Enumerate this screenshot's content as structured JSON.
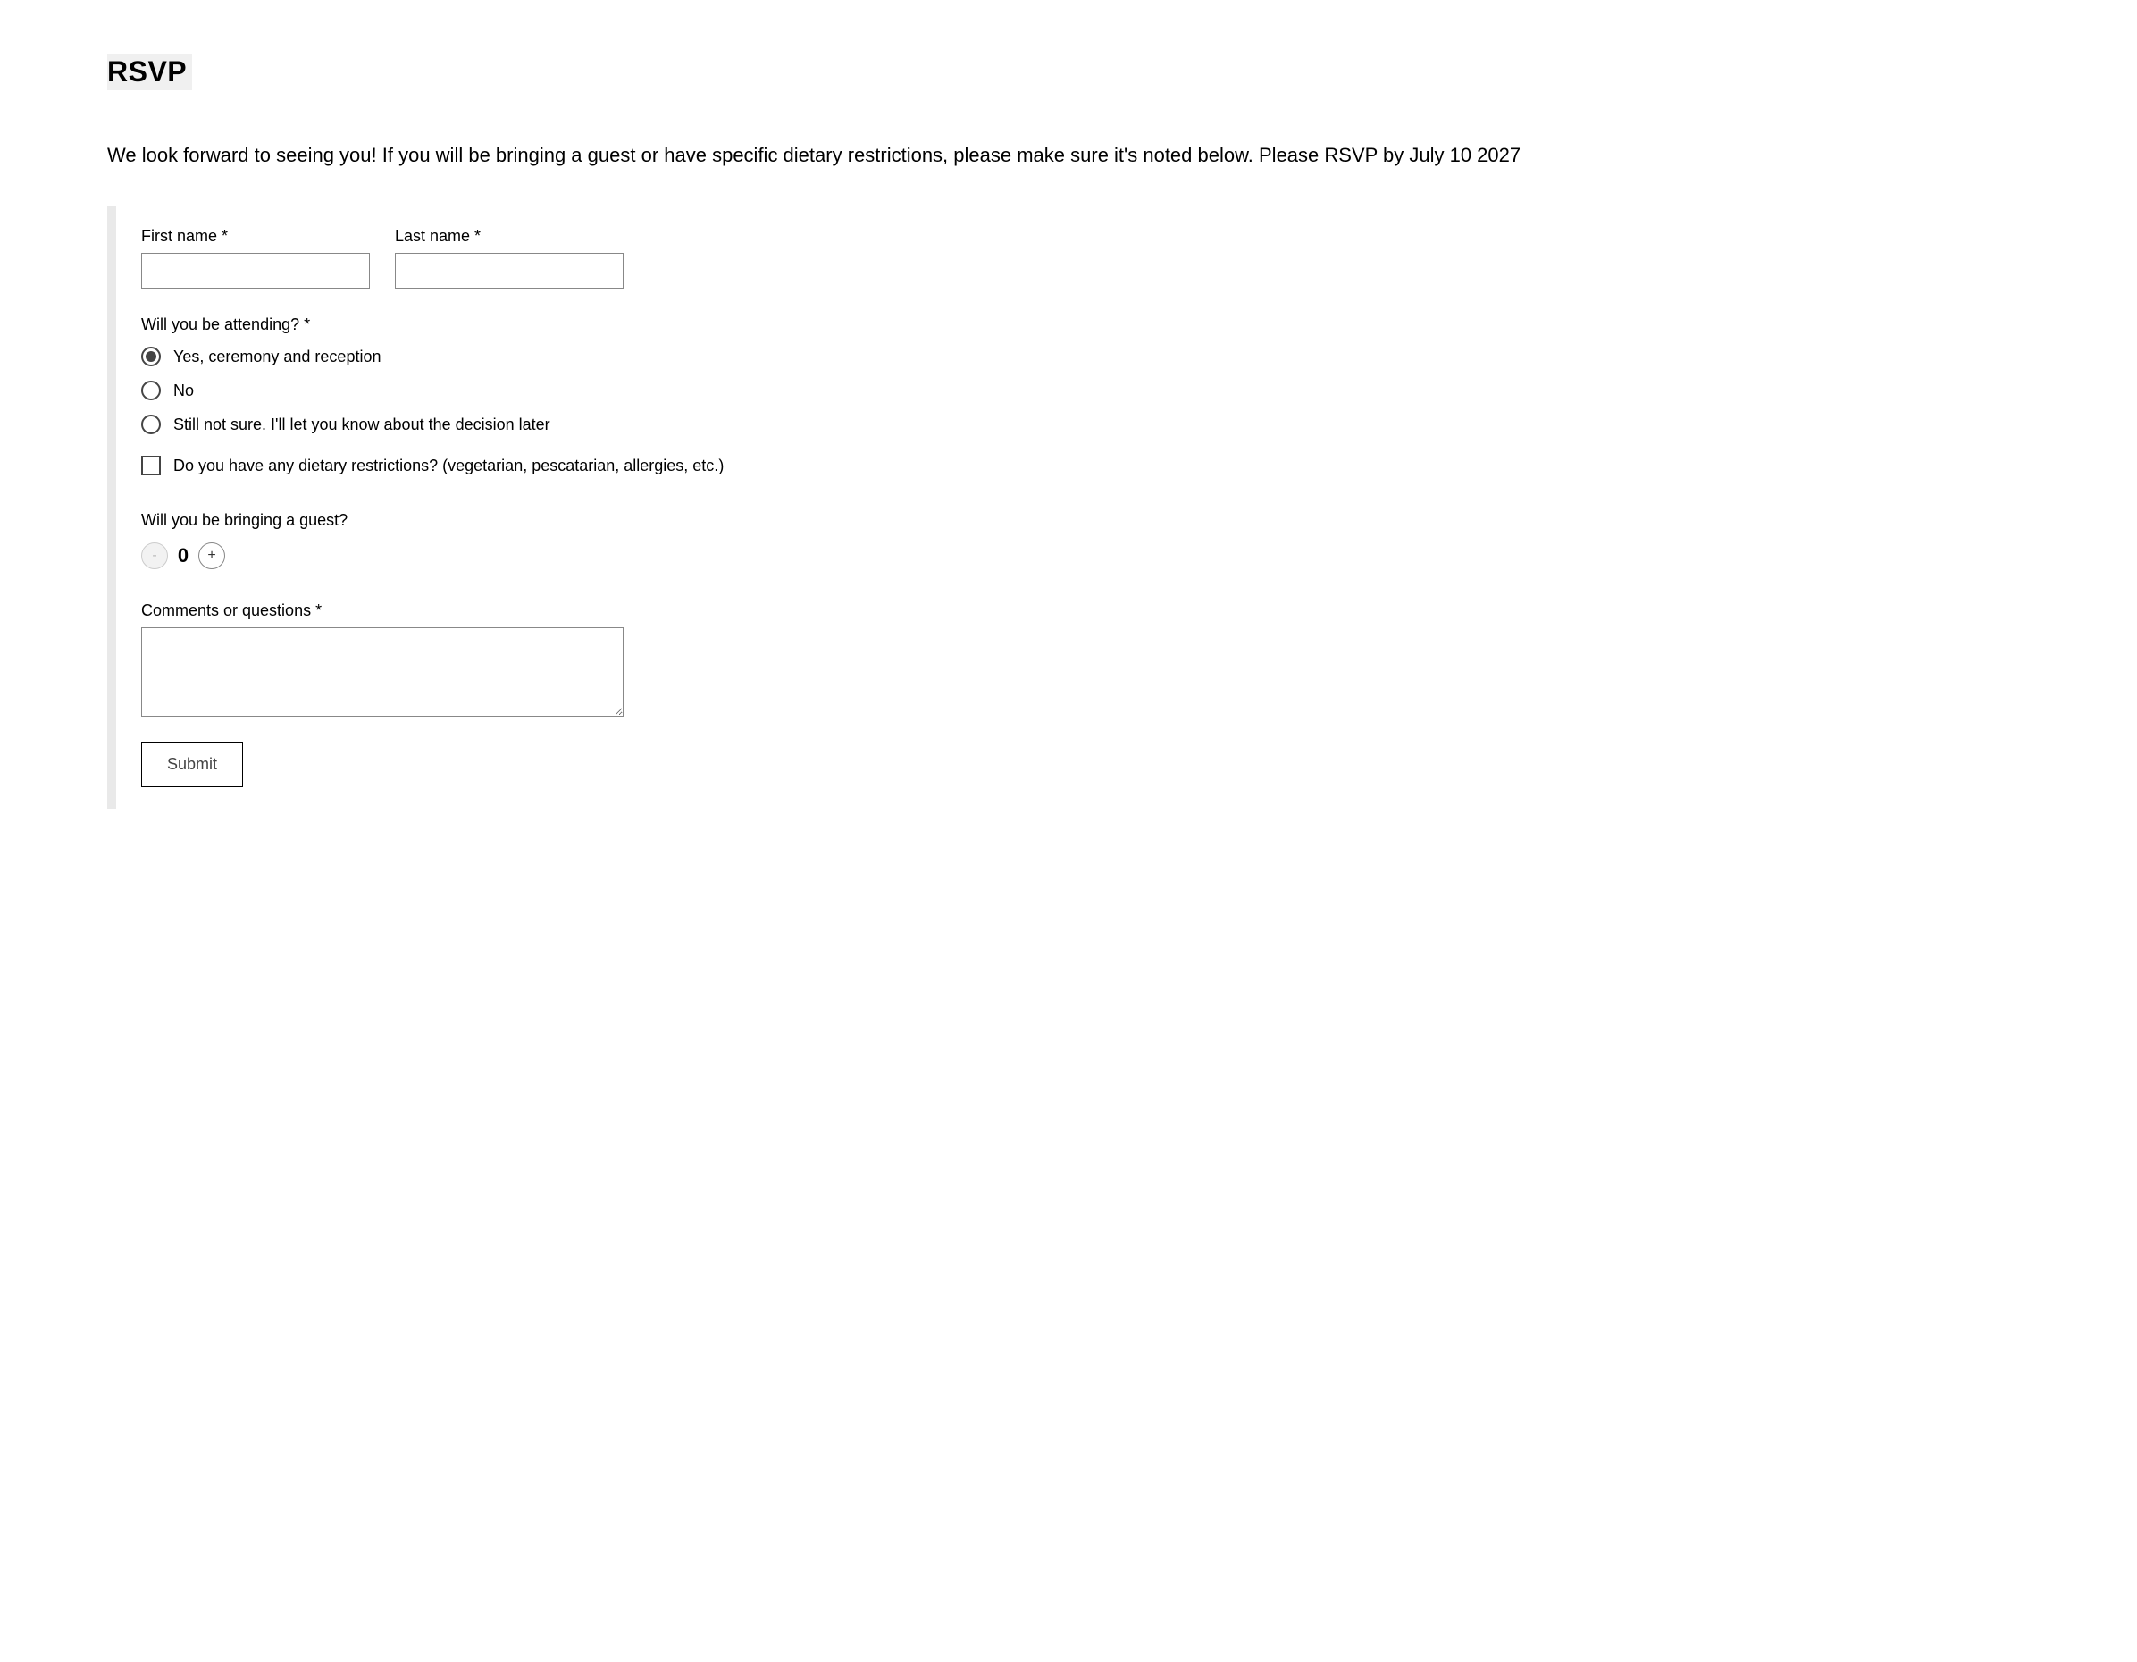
{
  "title": "RSVP",
  "intro": "We look forward to seeing you! If you will be bringing a guest or have specific dietary restrictions, please make sure it's noted below. Please RSVP by July 10 2027",
  "firstName": {
    "label": "First name *",
    "value": ""
  },
  "lastName": {
    "label": "Last name *",
    "value": ""
  },
  "attending": {
    "label": "Will you be attending? *",
    "options": {
      "yes": "Yes, ceremony and reception",
      "no": "No",
      "unsure": "Still not sure. I'll let you know about the decision later"
    },
    "selected": "yes"
  },
  "dietary": {
    "label": "Do you have any dietary restrictions? (vegetarian, pescatarian, allergies, etc.)",
    "checked": false
  },
  "guest": {
    "label": "Will you be bringing a guest?",
    "value": "0",
    "minusLabel": "-",
    "plusLabel": "+"
  },
  "comments": {
    "label": "Comments or questions *",
    "value": ""
  },
  "submitLabel": "Submit"
}
